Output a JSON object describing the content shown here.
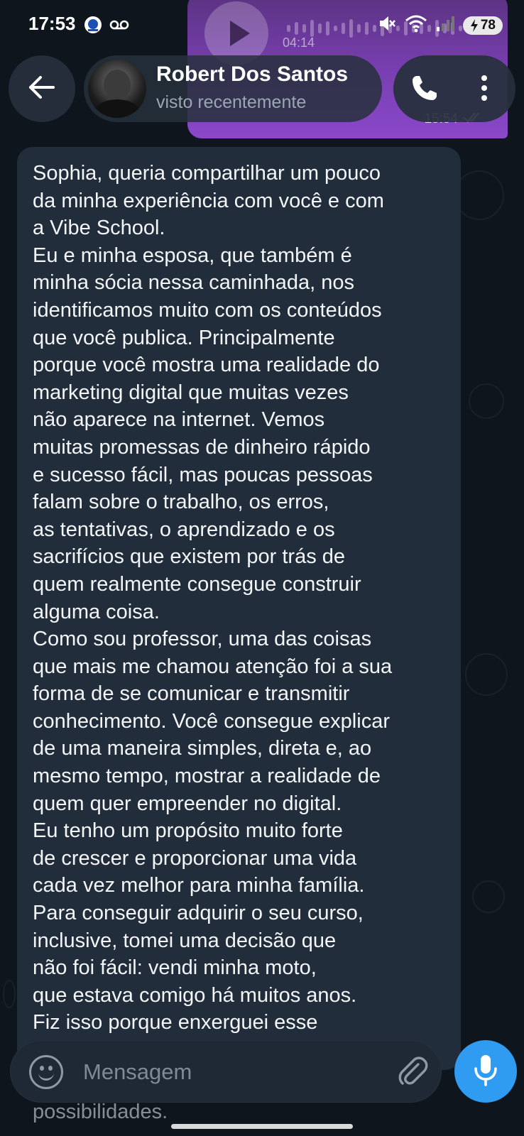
{
  "status_bar": {
    "time": "17:53",
    "battery": "78",
    "icons": [
      "app-badge-icon",
      "voicemail-icon",
      "mute-icon",
      "wifi-icon",
      "signal-icon",
      "battery-icon"
    ]
  },
  "previous_message": {
    "duration": "04:14",
    "time": "15:54"
  },
  "header": {
    "contact_name": "Robert Dos Santos",
    "contact_status": "visto recentemente"
  },
  "message": {
    "text": "Sophia, queria compartilhar um pouco\nda minha experiência com você e com\na Vibe School.\nEu e minha esposa, que também é\nminha sócia nessa caminhada, nos\nidentificamos muito com os conteúdos\nque você publica. Principalmente\nporque você mostra uma realidade do\nmarketing digital que muitas vezes\nnão aparece na internet. Vemos\nmuitas promessas de dinheiro rápido\ne sucesso fácil, mas poucas pessoas\nfalam sobre o trabalho, os erros,\nas tentativas, o aprendizado e os\nsacrifícios que existem por trás de\nquem realmente consegue construir\nalguma coisa.\nComo sou professor, uma das coisas\nque mais me chamou atenção foi a sua\nforma de se comunicar e transmitir\nconhecimento. Você consegue explicar\nde uma maneira simples, direta e, ao\nmesmo tempo, mostrar a realidade de\nquem quer empreender no digital.\nEu tenho um propósito muito forte\nde crescer e proporcionar uma vida\ncada vez melhor para minha família.\nPara conseguir adquirir o seu curso,\ninclusive, tomei uma decisão que\nnão foi fácil: vendi minha moto,\nque estava comigo há muitos anos.\nFiz isso porque enxerguei esse",
    "below_text": "possibilidades."
  },
  "composer": {
    "placeholder": "Mensagem"
  },
  "colors": {
    "background": "#0e151d",
    "bubble_incoming": "#212d3b",
    "bubble_outgoing": "#7a3fb3",
    "accent": "#2f9bf1"
  }
}
